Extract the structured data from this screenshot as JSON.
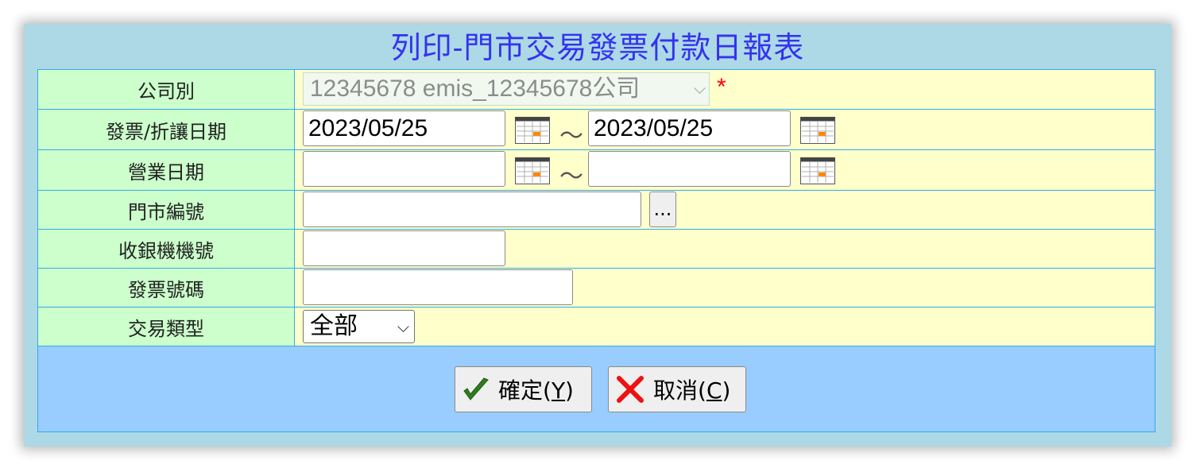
{
  "title": "列印-門市交易發票付款日報表",
  "fields": {
    "company": {
      "label": "公司別",
      "value": "12345678 emis_12345678公司",
      "required_mark": "*"
    },
    "invoice_date": {
      "label": "發票/折讓日期",
      "from": "2023/05/25",
      "to": "2023/05/25",
      "separator": "～"
    },
    "business_date": {
      "label": "營業日期",
      "from": "",
      "to": "",
      "separator": "～"
    },
    "store_no": {
      "label": "門市編號",
      "value": "",
      "browse_label": "..."
    },
    "register_no": {
      "label": "收銀機機號",
      "value": ""
    },
    "invoice_no": {
      "label": "發票號碼",
      "value": ""
    },
    "transaction_type": {
      "label": "交易類型",
      "value": "全部"
    }
  },
  "buttons": {
    "confirm": {
      "text": "確定(",
      "key": "Y",
      "close": ")"
    },
    "cancel": {
      "text": "取消(",
      "key": "C",
      "close": ")"
    }
  },
  "colors": {
    "title": "#3333ee",
    "label_bg": "#ccffcc",
    "field_bg": "#ffffcc",
    "button_bar": "#99ccff",
    "panel": "#add8e6",
    "required": "#ff0000"
  },
  "icons": {
    "calendar": "calendar-icon",
    "confirm": "checkmark-icon",
    "cancel": "cross-icon"
  }
}
